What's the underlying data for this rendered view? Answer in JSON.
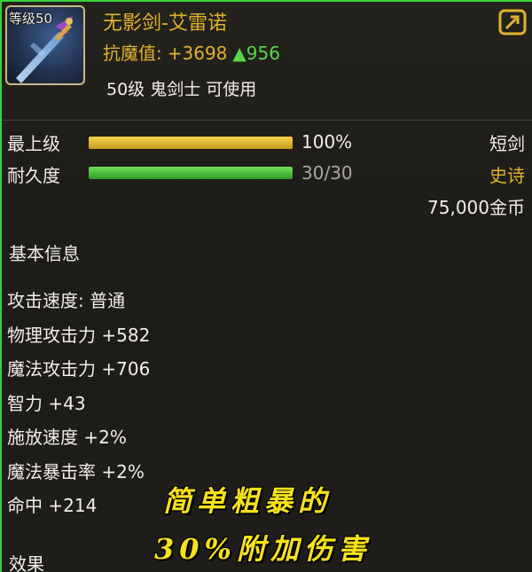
{
  "item": {
    "level_badge": "等级50",
    "title": "无影剑-艾雷诺",
    "resist_label": "抗魔值:",
    "resist_value": "+3698",
    "resist_gain": "▲956",
    "requirement": "50级 鬼剑士 可使用"
  },
  "bars": {
    "grade": {
      "label": "最上级",
      "value_text": "100%",
      "fill": 1.0
    },
    "durability": {
      "label": "耐久度",
      "value_text": "30/30",
      "fill": 1.0
    }
  },
  "tags": {
    "weapon_type": "短剑",
    "rarity": "史诗",
    "price": "75,000金币"
  },
  "sections": {
    "basic_info": "基本信息",
    "effects": "效果"
  },
  "stats": [
    "攻击速度: 普通",
    "物理攻击力 +582",
    "魔法攻击力 +706",
    "智力 +43",
    "施放速度 +2%",
    "魔法暴击率 +2%",
    "命中 +214"
  ],
  "overlay": {
    "line1": "简单粗暴的",
    "line2": "30%附加伤害"
  },
  "colors": {
    "title_gold": "#e0b22c",
    "gain_green": "#56d64a",
    "rarity": "#e0b22c",
    "overlay_yellow": "#f7e21a",
    "frame_green": "#3bd13b"
  },
  "icons": {
    "item_icon": "sword-icon",
    "share": "share-icon"
  }
}
